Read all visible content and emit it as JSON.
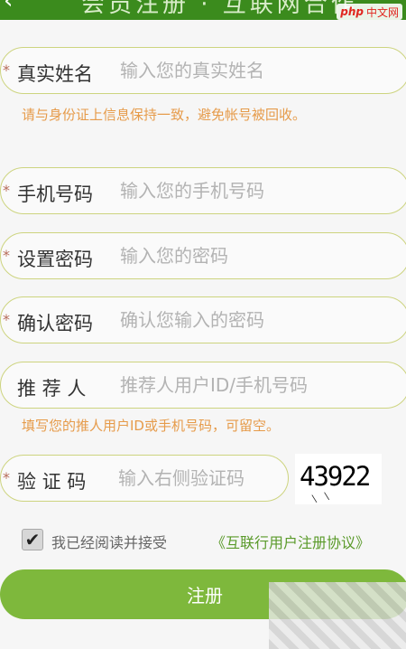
{
  "header": {
    "back_glyph": "‹",
    "title": "会员注册 · 互联网合作"
  },
  "watermark": {
    "php": "php",
    "cn": "中文网"
  },
  "form": {
    "required_mark": "*",
    "name": {
      "label": "真实姓名",
      "placeholder": "输入您的真实姓名",
      "value": ""
    },
    "name_hint": "请与身份证上信息保持一致，避免帐号被回收。",
    "phone": {
      "label": "手机号码",
      "placeholder": "输入您的手机号码",
      "value": ""
    },
    "password": {
      "label": "设置密码",
      "placeholder": "输入您的密码",
      "value": ""
    },
    "confirm": {
      "label": "确认密码",
      "placeholder": "确认您输入的密码",
      "value": ""
    },
    "referrer": {
      "label": "推 荐 人",
      "placeholder": "推荐人用户ID/手机号码",
      "value": ""
    },
    "referrer_hint": "填写您的推人用户ID或手机号码，可留空。",
    "captcha": {
      "label": "验 证 码",
      "placeholder": "输入右侧验证码",
      "value": "",
      "image_text": "43922"
    }
  },
  "agreement": {
    "checked": true,
    "check_glyph": "✔",
    "text": "我已经阅读并接受",
    "link": "《互联行用户注册协议》"
  },
  "submit_label": "注册",
  "colors": {
    "accent_green": "#7eb83c",
    "header_green": "#3b8b1d",
    "hint_orange": "#e69b4a",
    "field_border": "#cdd47f"
  }
}
